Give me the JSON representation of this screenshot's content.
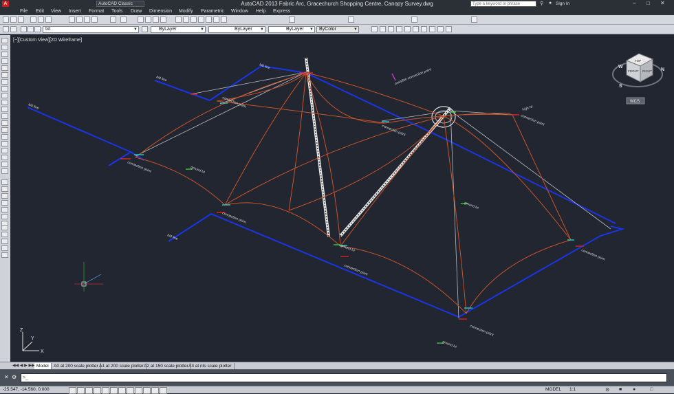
{
  "window": {
    "title": "AutoCAD 2013    Fabric Arc, Gracechurch Shopping Centre, Canopy Survey.dwg",
    "workspace": "AutoCAD Classic",
    "search_placeholder": "Type a keyword or phrase",
    "sign_in": "Sign In"
  },
  "menu": [
    "File",
    "Edit",
    "View",
    "Insert",
    "Format",
    "Tools",
    "Draw",
    "Dimension",
    "Modify",
    "Parametric",
    "Window",
    "Help",
    "Express"
  ],
  "toolbar": {
    "layer": "txt",
    "color": "ByLayer",
    "linetype": "ByLayer",
    "lineweight": "ByLayer",
    "plotstyle": "ByColor"
  },
  "viewport": {
    "label": "[−][Custom View][2D Wireframe]",
    "viewcube": {
      "top": "TOP",
      "front": "FRONT",
      "right": "RIGHT",
      "north": "N",
      "west": "W",
      "south": "S",
      "ucs": "WCS"
    },
    "ucs_axes": {
      "x": "X",
      "y": "Y",
      "z": "Z"
    }
  },
  "drawing_labels": {
    "bld_line": "bld line",
    "connection_point": "connection point",
    "ground_lvl": "ground lvl",
    "high_lvl": "high lvl",
    "possible_connection": "possible connection point"
  },
  "tabs": [
    "Model",
    "A0 at 200 scale plotter",
    "A1 at 200 scale plotter",
    "A2 at 150 scale plotter",
    "A3 at nts scale plotter"
  ],
  "active_tab": "Model",
  "status": {
    "coordinates": "-25.547, -14.560, 0.000",
    "model": "MODEL",
    "scale": "1:1"
  },
  "colors": {
    "building_line": "#1a35e6",
    "fabric_edge": "#c8542a",
    "mast": "#e8e8e8",
    "cable": "#b9bcc2",
    "connection": "#22c9c9",
    "ground": "#3ec93e",
    "marker_red": "#e02222",
    "background": "#212630"
  }
}
